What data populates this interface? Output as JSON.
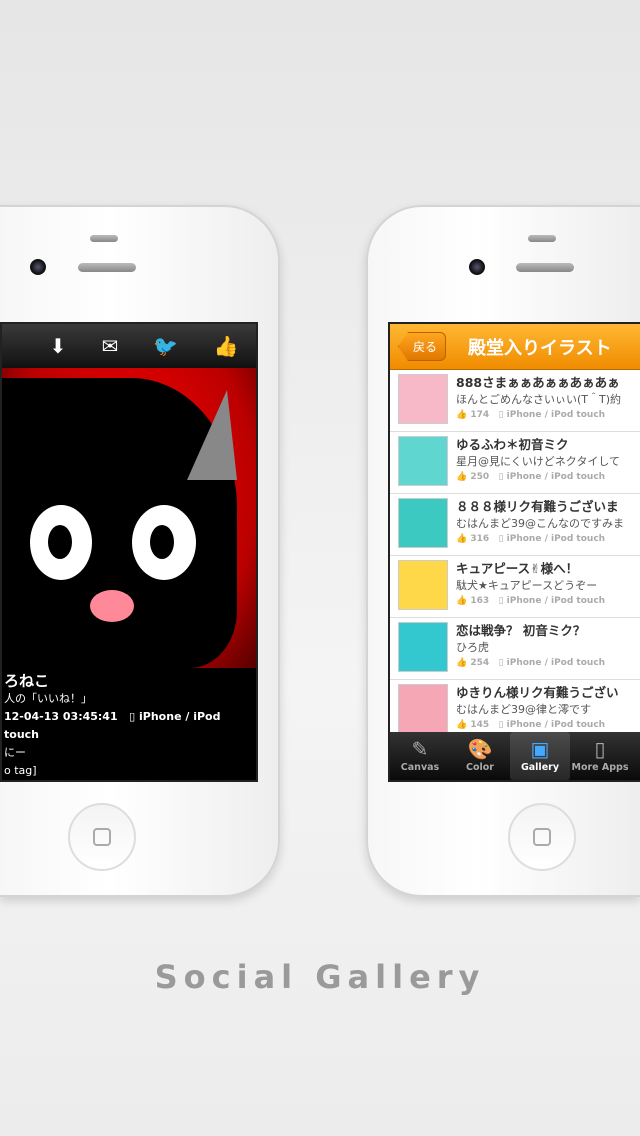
{
  "caption": "Social Gallery",
  "left_screen": {
    "toolbar_icons": [
      "save-to-folder-icon",
      "mail-icon",
      "twitter-icon",
      "like-icon"
    ],
    "title_partial": "ろねこ",
    "likes_partial": "人の「いいね！」",
    "datetime_partial": "12-04-13 03:45:41",
    "device": "iPhone / iPod touch",
    "comment_partial": "にー",
    "tag_partial": "o tag]"
  },
  "right_screen": {
    "back_label": "戻る",
    "title": "殿堂入りイラスト",
    "accent": "#f39800",
    "items": [
      {
        "title": "888さまぁぁあぁぁあぁあぁ",
        "subtitle": "ほんとごめんなさいぃい(T＾T)約",
        "likes": "174",
        "device": "iPhone / iPod touch",
        "thumb": "#f7b8c8"
      },
      {
        "title": "ゆるふわ＊初音ミク",
        "subtitle": "星月@見にくいけどネクタイして",
        "likes": "250",
        "device": "iPhone / iPod touch",
        "thumb": "#5fd6d0"
      },
      {
        "title": "８８８様リク有難うございま",
        "subtitle": "むはんまど39@こんなのですみま",
        "likes": "316",
        "device": "iPhone / iPod touch",
        "thumb": "#3cc9c2"
      },
      {
        "title": "キュアピース✌様へ！",
        "subtitle": "駄犬★キュアピースどうぞー",
        "likes": "163",
        "device": "iPhone / iPod touch",
        "thumb": "#ffd84a"
      },
      {
        "title": "恋は戦争？ 初音ミク？",
        "subtitle": "ひろ虎",
        "likes": "254",
        "device": "iPhone / iPod touch",
        "thumb": "#33c7cf"
      },
      {
        "title": "ゆきりん様リク有難うござい",
        "subtitle": "むはんまど39@律と澪です",
        "likes": "145",
        "device": "iPhone / iPod touch",
        "thumb": "#f5a7b6"
      }
    ],
    "tabs": [
      {
        "label": "Canvas",
        "icon": "canvas-icon"
      },
      {
        "label": "Color",
        "icon": "palette-icon"
      },
      {
        "label": "Gallery",
        "icon": "gallery-icon",
        "active": true
      },
      {
        "label": "More Apps",
        "icon": "phone-icon"
      }
    ]
  }
}
